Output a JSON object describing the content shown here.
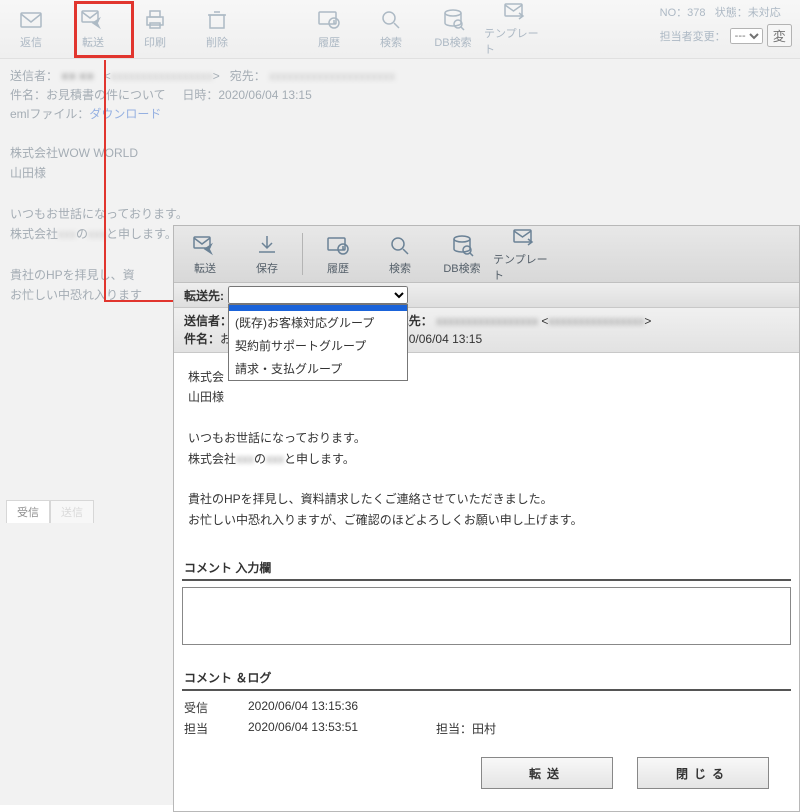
{
  "bg": {
    "toolbar": {
      "reply": "返信",
      "forward": "転送",
      "print": "印刷",
      "delete": "削除",
      "history": "履歴",
      "search": "検索",
      "dbsearch": "DB検索",
      "template": "テンプレート"
    },
    "status": {
      "no_label": "NO：",
      "no": "378",
      "state_label": "状態：",
      "state": "未対応",
      "assignee_change_label": "担当者変更：",
      "change_btn": "変"
    },
    "meta": {
      "sender_label": "送信者：",
      "sender_masked": "■■ ■■",
      "recipient_label": "宛先：",
      "subject_label": "件名：",
      "subject": "お見積書の件について",
      "datetime_label": "日時：",
      "datetime": "2020/06/04 13:15",
      "eml_label": "emlファイル：",
      "eml_link": "ダウンロード"
    },
    "body": {
      "l1": "株式会社WOW WORLD",
      "l2": "山田様",
      "l3": "いつもお世話になっております。",
      "l4_a": "株式会社",
      "l4_b": "の",
      "l4_c": "と申します。",
      "l5": "貴社のHPを拝見し、資",
      "l6": "お忙しい中恐れ入ります"
    },
    "tabs": {
      "receive": "受信",
      "sent": "送信"
    }
  },
  "win": {
    "toolbar": {
      "forward": "転送",
      "save": "保存",
      "history": "履歴",
      "search": "検索",
      "dbsearch": "DB検索",
      "template": "テンプレート"
    },
    "transfer_label": "転送先:",
    "dropdown": {
      "opt0": "",
      "opt1": "(既存)お客様対応グループ",
      "opt2": "契約前サポートグループ",
      "opt3": "請求・支払グループ"
    },
    "meta": {
      "sender_label": "送信者：",
      "recipient_label": "宛先：",
      "subject_label": "件名：",
      "subject_masked": "お",
      "datetime_part": "0/06/04 13:15"
    },
    "body": {
      "l1": "株式会",
      "l2": "山田様",
      "l3": "いつもお世話になっております。",
      "l4_a": "株式会社",
      "l4_b": "の",
      "l4_c": "と申します。",
      "l5": "貴社のHPを拝見し、資料請求したくご連絡させていただきました。",
      "l6": "お忙しい中恐れ入りますが、ご確認のほどよろしくお願い申し上げます。"
    },
    "comment_title": "コメント 入力欄",
    "log_title": "コメント ＆ログ",
    "log": {
      "r1_c1": "受信",
      "r1_c2": "2020/06/04 13:15:36",
      "r2_c1": "担当",
      "r2_c2": "2020/06/04 13:53:51",
      "r2_c3_label": "担当：",
      "r2_c3": "田村"
    },
    "buttons": {
      "forward": "転送",
      "close": "閉じる"
    }
  }
}
